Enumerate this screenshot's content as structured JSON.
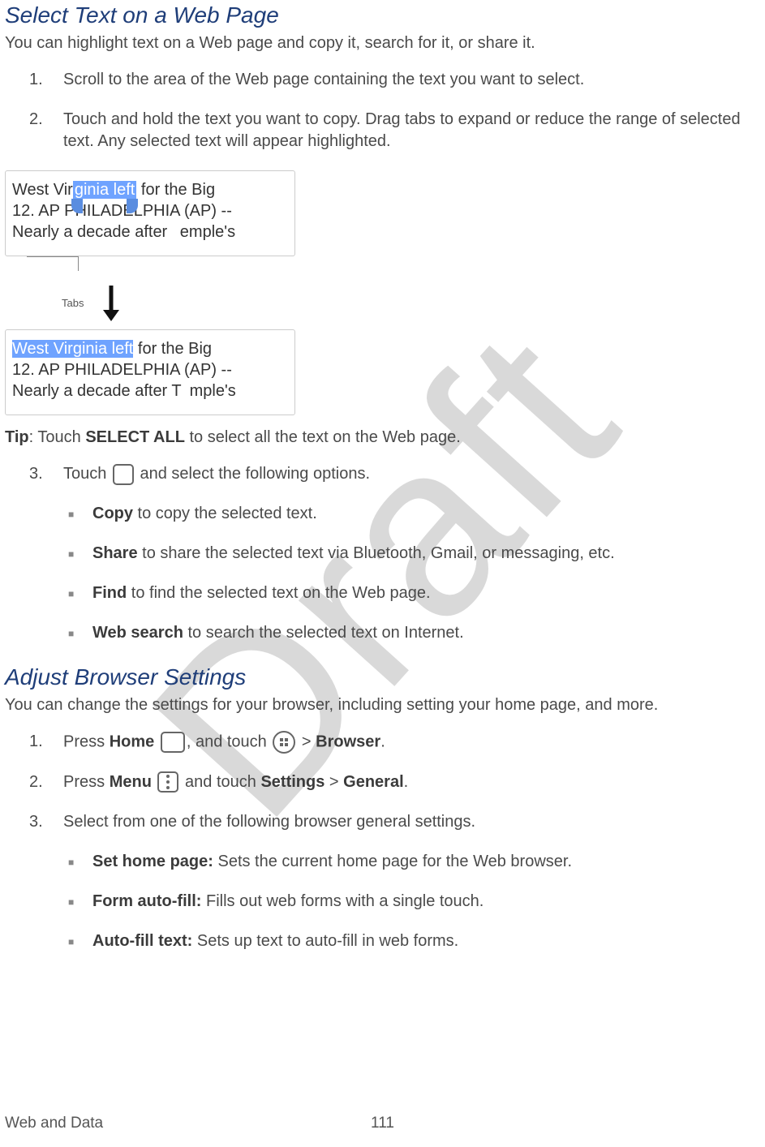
{
  "watermark": "Draft",
  "section1": {
    "heading": "Select Text on a Web Page",
    "intro": "You can highlight text on a Web page and copy it, search for it, or share it.",
    "steps": {
      "s1": {
        "num": "1.",
        "text": "Scroll to the area of the Web page containing the text you want to select."
      },
      "s2": {
        "num": "2.",
        "text": "Touch and hold the text you want to copy. Drag tabs to expand or reduce the range of selected text. Any selected text will appear highlighted."
      },
      "s3": {
        "num": "3.",
        "pre": " Touch ",
        "post": " and select the following options."
      }
    },
    "figure": {
      "line1_a": "West Vir",
      "line1_hl": "ginia left",
      "line1_b": " for the Big",
      "line2": "12. AP PHILADELPHIA (AP) --",
      "line3_a": "Nearly a decade after ",
      "line3_b": "emple's",
      "tabs_label": "Tabs",
      "p2_line1_a": "West Virginia left",
      "p2_line1_b": " for the Big",
      "p2_line2": "12. AP PHILADELPHIA (AP) --",
      "p2_line3_a": "Nearly a decade after T",
      "p2_line3_b": "mple's"
    },
    "tip": {
      "label": "Tip",
      "pre": ": Touch ",
      "bold": "SELECT ALL",
      "post": " to select all the text on the Web page."
    },
    "options": {
      "copy": {
        "bold": "Copy",
        "text": " to copy the selected text."
      },
      "share": {
        "bold": "Share",
        "text": " to share the selected text via Bluetooth, Gmail, or messaging, etc."
      },
      "find": {
        "bold": "Find",
        "text": " to find the selected text on the Web page."
      },
      "web": {
        "bold": "Web search",
        "text": " to search the selected text on Internet."
      }
    }
  },
  "section2": {
    "heading": "Adjust Browser Settings",
    "intro": "You can change the settings for your browser, including setting your home page, and more.",
    "steps": {
      "s1": {
        "num": "1.",
        "a": " Press ",
        "home": "Home",
        "b": ", and touch ",
        "c": " > ",
        "browser": "Browser",
        "d": "."
      },
      "s2": {
        "num": "2.",
        "a": " Press ",
        "menu": "Menu",
        "b": " and touch ",
        "settings": "Settings",
        "c": " > ",
        "general": "General",
        "d": "."
      },
      "s3": {
        "num": "3.",
        "text": "Select from one of the following browser general settings."
      }
    },
    "options": {
      "home": {
        "bold": "Set home page:",
        "text": " Sets the current home page for the Web browser."
      },
      "form": {
        "bold": "Form auto-fill:",
        "text": " Fills out web forms with a single touch."
      },
      "auto": {
        "bold": "Auto-fill text:",
        "text": " Sets up text to auto-fill in web forms."
      }
    }
  },
  "footer": {
    "section": "Web and Data",
    "page": "111"
  }
}
